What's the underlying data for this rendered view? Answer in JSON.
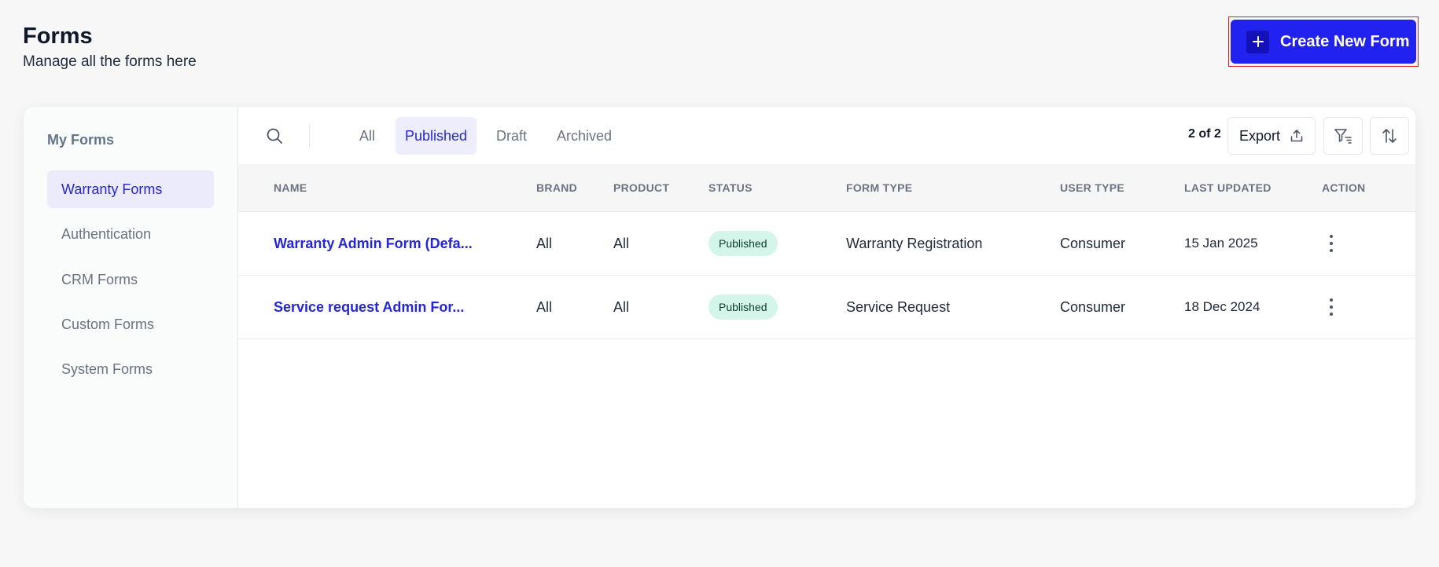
{
  "header": {
    "title": "Forms",
    "subtitle": "Manage all the forms here",
    "create_button": "Create New Form"
  },
  "sidebar": {
    "title": "My Forms",
    "items": [
      {
        "label": "Warranty Forms",
        "active": true
      },
      {
        "label": "Authentication",
        "active": false
      },
      {
        "label": "CRM Forms",
        "active": false
      },
      {
        "label": "Custom Forms",
        "active": false
      },
      {
        "label": "System Forms",
        "active": false
      }
    ]
  },
  "toolbar": {
    "tabs": [
      {
        "label": "All",
        "active": false
      },
      {
        "label": "Published",
        "active": true
      },
      {
        "label": "Draft",
        "active": false
      },
      {
        "label": "Archived",
        "active": false
      }
    ],
    "count": "2 of 2",
    "export_label": "Export"
  },
  "table": {
    "columns": [
      "NAME",
      "BRAND",
      "PRODUCT",
      "STATUS",
      "FORM TYPE",
      "USER TYPE",
      "LAST UPDATED",
      "ACTION"
    ],
    "rows": [
      {
        "name": "Warranty Admin Form (Defa...",
        "brand": "All",
        "product": "All",
        "status": "Published",
        "form_type": "Warranty Registration",
        "user_type": "Consumer",
        "last_updated": "15 Jan 2025"
      },
      {
        "name": "Service request Admin For...",
        "brand": "All",
        "product": "All",
        "status": "Published",
        "form_type": "Service Request",
        "user_type": "Consumer",
        "last_updated": "18 Dec 2024"
      }
    ]
  },
  "colors": {
    "accent": "#2121f0",
    "active_bg": "#ebebfc",
    "badge_bg": "#d4f5ea"
  },
  "icons": [
    "plus-icon",
    "search-icon",
    "export-icon",
    "filter-icon",
    "sort-icon",
    "kebab-menu-icon"
  ]
}
